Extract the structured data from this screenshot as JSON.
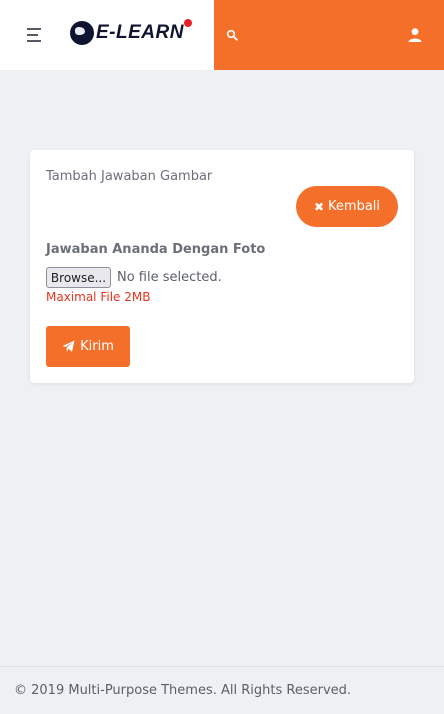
{
  "header": {
    "logo_text": "E-LEARN",
    "accent_color": "#f4702a",
    "icons": {
      "menu": "menu-icon",
      "search": "search-icon",
      "user": "user-icon"
    }
  },
  "card": {
    "title": "Tambah Jawaban Gambar",
    "back_button": {
      "icon": "times-icon",
      "label": "Kembali"
    },
    "field_label": "Jawaban Ananda Dengan Foto",
    "file_input": {
      "browse_label": "Browse...",
      "status": "No file selected."
    },
    "hint": "Maximal File 2MB",
    "hint_color": "#e8341f",
    "submit_button": {
      "icon": "paper-plane-icon",
      "label": "Kirim"
    }
  },
  "footer": {
    "text": "© 2019 Multi-Purpose Themes. All Rights Reserved."
  }
}
